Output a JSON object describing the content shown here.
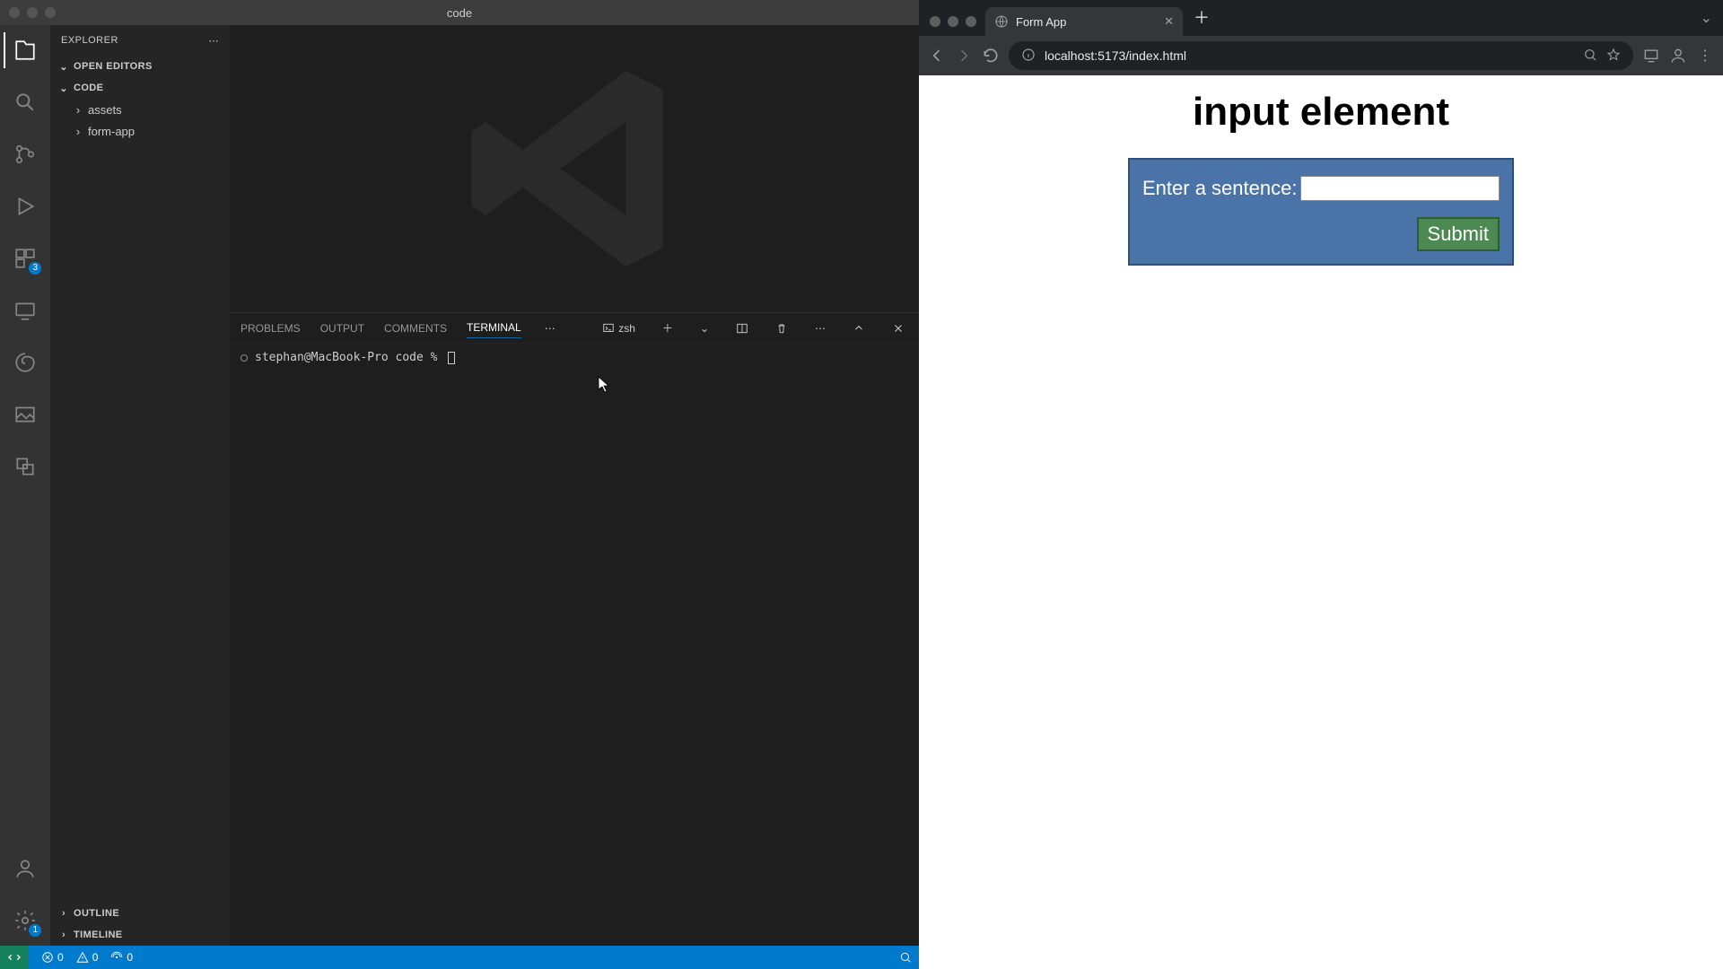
{
  "vscode": {
    "title": "code",
    "explorer": {
      "header": "EXPLORER",
      "sections": {
        "open_editors": "OPEN EDITORS",
        "root": "CODE",
        "outline": "OUTLINE",
        "timeline": "TIMELINE"
      },
      "tree": [
        {
          "name": "assets",
          "type": "folder"
        },
        {
          "name": "form-app",
          "type": "folder"
        }
      ]
    },
    "activity_badge_extensions": "3",
    "activity_badge_settings": "1",
    "panel": {
      "tabs": [
        "PROBLEMS",
        "OUTPUT",
        "COMMENTS",
        "TERMINAL"
      ],
      "active": "TERMINAL",
      "shell": "zsh",
      "prompt": "stephan@MacBook-Pro code % "
    },
    "status": {
      "errors": "0",
      "warnings": "0",
      "ports": "0"
    }
  },
  "browser": {
    "tab_title": "Form App",
    "url": "localhost:5173/index.html"
  },
  "page": {
    "heading": "input element",
    "label": "Enter a sentence:",
    "submit": "Submit"
  }
}
